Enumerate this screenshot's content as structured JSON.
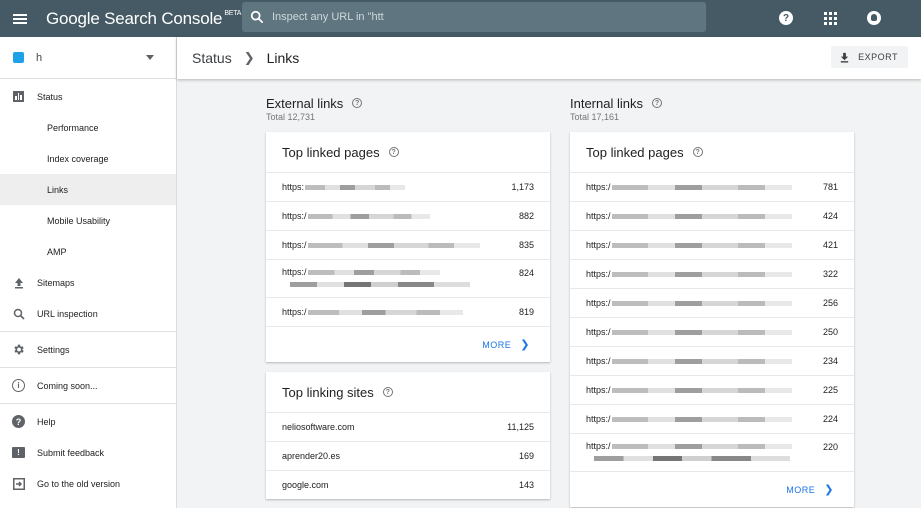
{
  "app": {
    "brand": "Google Search Console",
    "brand_badge": "BETA"
  },
  "search": {
    "placeholder": "Inspect any URL in \"htt"
  },
  "topbar_icons": [
    "help-icon",
    "apps-icon",
    "account-icon"
  ],
  "property": {
    "name": "h"
  },
  "sidebar": {
    "items": [
      {
        "label": "Status",
        "icon": "bar-chart-icon",
        "sub": false
      },
      {
        "label": "Performance",
        "sub": true
      },
      {
        "label": "Index coverage",
        "sub": true
      },
      {
        "label": "Links",
        "sub": true,
        "active": true
      },
      {
        "label": "Mobile Usability",
        "sub": true
      },
      {
        "label": "AMP",
        "sub": true
      },
      {
        "label": "Sitemaps",
        "icon": "upload-icon",
        "sub": false
      },
      {
        "label": "URL inspection",
        "icon": "search-icon",
        "sub": false
      },
      {
        "label": "Settings",
        "icon": "gear-icon",
        "sub": false
      },
      {
        "label": "Coming soon...",
        "icon": "info-icon",
        "sub": false
      },
      {
        "label": "Help",
        "icon": "help-icon",
        "sub": false
      },
      {
        "label": "Submit feedback",
        "icon": "feedback-icon",
        "sub": false
      },
      {
        "label": "Go to the old version",
        "icon": "exit-icon",
        "sub": false
      }
    ]
  },
  "header": {
    "crumb_root": "Status",
    "crumb_current": "Links",
    "export_label": "EXPORT"
  },
  "external": {
    "title": "External links",
    "total": "Total 12,731",
    "top_linked": {
      "title": "Top linked pages",
      "rows": [
        {
          "url": "https:",
          "value": "1,173"
        },
        {
          "url": "https:/",
          "value": "882"
        },
        {
          "url": "https:/",
          "value": "835"
        },
        {
          "url": "https:/",
          "value": "824"
        },
        {
          "url": "https:/",
          "value": "819"
        }
      ],
      "more": "MORE"
    },
    "top_linking_sites": {
      "title": "Top linking sites",
      "rows": [
        {
          "url": "neliosoftware.com",
          "value": "11,125"
        },
        {
          "url": "aprender20.es",
          "value": "169"
        },
        {
          "url": "google.com",
          "value": "143"
        }
      ]
    }
  },
  "internal": {
    "title": "Internal links",
    "total": "Total 17,161",
    "top_linked": {
      "title": "Top linked pages",
      "rows": [
        {
          "url": "https:/",
          "value": "781"
        },
        {
          "url": "https:/",
          "value": "424"
        },
        {
          "url": "https:/",
          "value": "421"
        },
        {
          "url": "https:/",
          "value": "322"
        },
        {
          "url": "https:/",
          "value": "256"
        },
        {
          "url": "https:/",
          "value": "250"
        },
        {
          "url": "https:/",
          "value": "234"
        },
        {
          "url": "https:/",
          "value": "225"
        },
        {
          "url": "https:/",
          "value": "224"
        },
        {
          "url": "https:/",
          "value": "220"
        }
      ],
      "more": "MORE"
    }
  }
}
